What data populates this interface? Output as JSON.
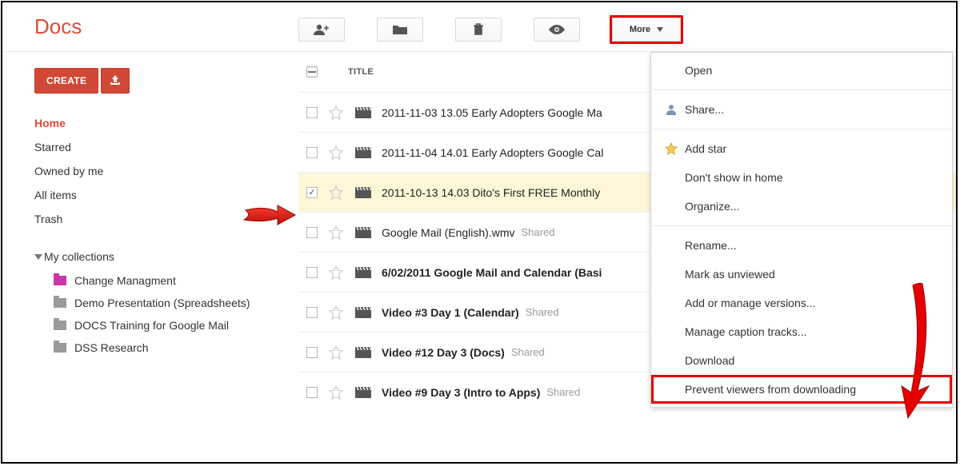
{
  "app_title": "Docs",
  "toolbar": {
    "more_label": "More"
  },
  "sidebar": {
    "create_label": "CREATE",
    "nav": [
      "Home",
      "Starred",
      "Owned by me",
      "All items",
      "Trash"
    ],
    "active_nav_index": 0,
    "collections_header": "My collections",
    "collections": [
      {
        "label": "Change Managment",
        "color": "pink"
      },
      {
        "label": "Demo Presentation (Spreadsheets)",
        "color": "grey"
      },
      {
        "label": "DOCS Training for Google Mail",
        "color": "grey"
      },
      {
        "label": "DSS Research",
        "color": "grey"
      }
    ]
  },
  "doclist": {
    "column_title": "TITLE",
    "shared_label": "Shared",
    "rows": [
      {
        "title": "2011-11-03 13.05 Early Adopters Google Ma",
        "selected": false,
        "bold": false,
        "shared": false
      },
      {
        "title": "2011-11-04 14.01 Early Adopters Google Cal",
        "selected": false,
        "bold": false,
        "shared": false
      },
      {
        "title": "2011-10-13 14.03 Dito's First FREE Monthly",
        "selected": true,
        "bold": false,
        "shared": false
      },
      {
        "title": "Google Mail (English).wmv",
        "selected": false,
        "bold": false,
        "shared": true
      },
      {
        "title": "6/02/2011 Google Mail and Calendar (Basi",
        "selected": false,
        "bold": true,
        "shared": false
      },
      {
        "title": "Video #3 Day 1 (Calendar)",
        "selected": false,
        "bold": true,
        "shared": true
      },
      {
        "title": "Video #12 Day 3 (Docs)",
        "selected": false,
        "bold": true,
        "shared": true
      },
      {
        "title": "Video #9 Day 3 (Intro to Apps)",
        "selected": false,
        "bold": true,
        "shared": true
      }
    ]
  },
  "more_menu": {
    "items": [
      {
        "label": "Open"
      },
      {
        "sep": true
      },
      {
        "label": "Share...",
        "icon": "person"
      },
      {
        "sep": true
      },
      {
        "label": "Add star",
        "icon": "star"
      },
      {
        "label": "Don't show in home"
      },
      {
        "label": "Organize..."
      },
      {
        "sep": true
      },
      {
        "label": "Rename..."
      },
      {
        "label": "Mark as unviewed"
      },
      {
        "label": "Add or manage versions..."
      },
      {
        "label": "Manage caption tracks..."
      },
      {
        "label": "Download"
      },
      {
        "label": "Prevent viewers from downloading",
        "highlight": true
      }
    ]
  }
}
